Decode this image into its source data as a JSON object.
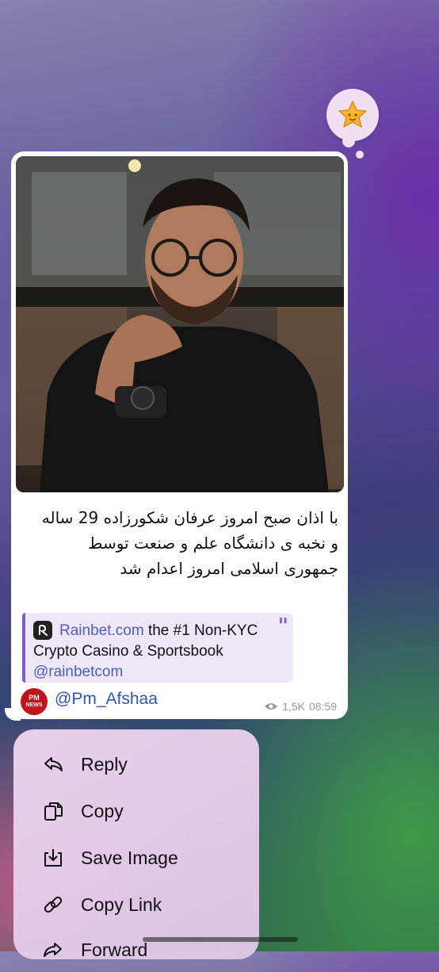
{
  "reaction": {
    "emoji_icon": "star-emoji-icon"
  },
  "message": {
    "text_lines": [
      "با اذان صبح امروز عرفان شکورزاده 29 ساله",
      "و نخبه ی دانشگاه علم و صنعت توسط",
      "جمهوری اسلامی امروز اعدام شد"
    ],
    "ad": {
      "link_text": "Rainbet.com",
      "line1_rest": " the #1 Non-KYC",
      "line2": "Crypto Casino & Sportsbook",
      "line3": "@rainbetcom",
      "logo_icon": "rainbet-logo-icon"
    },
    "signature": {
      "avatar_line1": "PM",
      "avatar_line2": "NEWS",
      "handle": "@Pm_Afshaa"
    },
    "views": "1,5K",
    "time": "08:59"
  },
  "menu": {
    "items": [
      {
        "label": "Reply",
        "icon": "reply-icon"
      },
      {
        "label": "Copy",
        "icon": "copy-icon"
      },
      {
        "label": "Save Image",
        "icon": "save-image-icon"
      },
      {
        "label": "Copy Link",
        "icon": "link-icon"
      },
      {
        "label": "Forward",
        "icon": "forward-icon"
      }
    ]
  },
  "colors": {
    "accent": "#7f5bd1",
    "link": "#2f55c0",
    "bubble": "#ffffff"
  }
}
